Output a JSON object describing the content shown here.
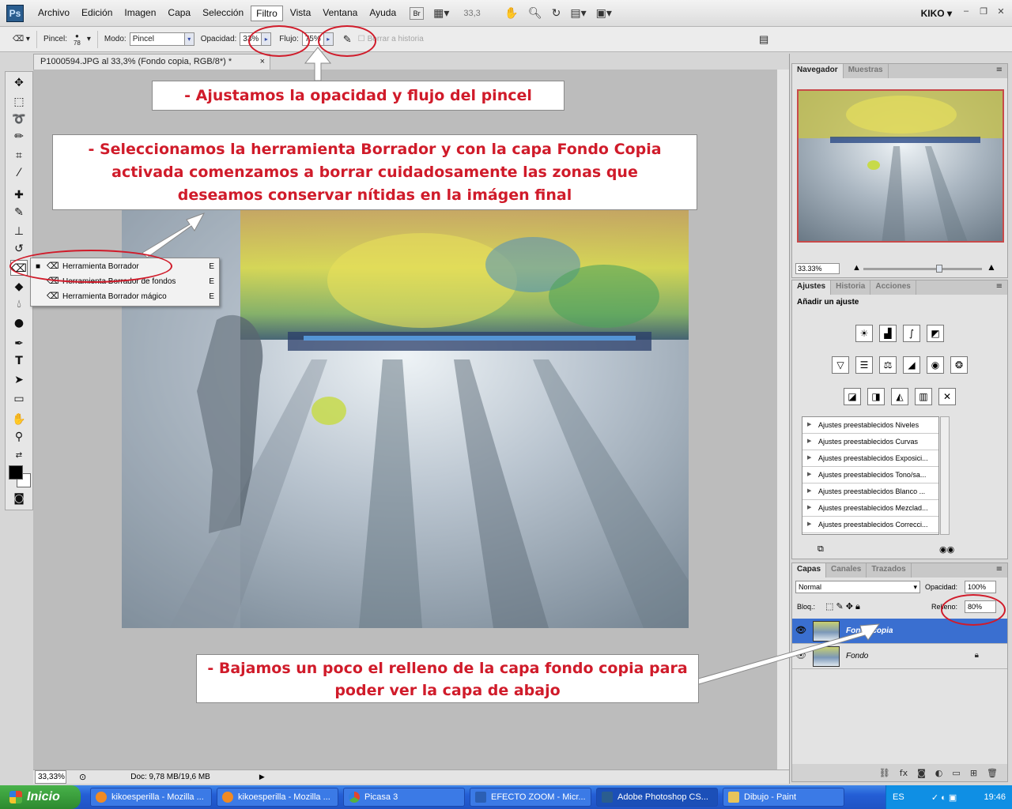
{
  "menubar": {
    "logo": "Ps",
    "items": [
      "Archivo",
      "Edición",
      "Imagen",
      "Capa",
      "Selección",
      "Filtro",
      "Vista",
      "Ventana",
      "Ayuda"
    ],
    "active_item": "Filtro",
    "bridge_label": "Br",
    "zoom": "33,3",
    "user": "KIKO"
  },
  "options": {
    "brush_label": "Pincel:",
    "brush_size": "78",
    "mode_label": "Modo:",
    "mode_value": "Pincel",
    "opacity_label": "Opacidad:",
    "opacity_value": "33%",
    "flow_label": "Flujo:",
    "flow_value": "75%",
    "history_label": "Borrar a historia"
  },
  "document": {
    "tab_title": "P1000594.JPG al 33,3% (Fondo copia, RGB/8*) *",
    "status_zoom": "33,33%",
    "status_doc": "Doc: 9,78 MB/19,6 MB"
  },
  "flyout": {
    "items": [
      {
        "label": "Herramienta Borrador",
        "key": "E"
      },
      {
        "label": "Herramienta Borrador de fondos",
        "key": "E"
      },
      {
        "label": "Herramienta Borrador mágico",
        "key": "E"
      }
    ]
  },
  "navigator": {
    "tabs": [
      "Navegador",
      "Muestras"
    ],
    "zoom": "33.33%"
  },
  "adjustments": {
    "tabs": [
      "Ajustes",
      "Historia",
      "Acciones"
    ],
    "title": "Añadir un ajuste",
    "presets": [
      "Ajustes preestablecidos Niveles",
      "Ajustes preestablecidos Curvas",
      "Ajustes preestablecidos Exposici...",
      "Ajustes preestablecidos Tono/sa...",
      "Ajustes preestablecidos Blanco ...",
      "Ajustes preestablecidos Mezclad...",
      "Ajustes preestablecidos Correcci..."
    ]
  },
  "layers": {
    "tabs": [
      "Capas",
      "Canales",
      "Trazados"
    ],
    "blend_mode": "Normal",
    "opacity_label": "Opacidad:",
    "opacity_value": "100%",
    "lock_label": "Bloq.:",
    "fill_label": "Relleno:",
    "fill_value": "80%",
    "items": [
      {
        "name": "Fondo copia",
        "selected": true
      },
      {
        "name": "Fondo",
        "selected": false
      }
    ]
  },
  "annotations": {
    "opacity_note": "- Ajustamos la opacidad y flujo del pincel",
    "eraser_note": "- Seleccionamos la herramienta Borrador y con la capa Fondo Copia  activada comenzamos a borrar  cuidadosamente  las zonas que deseamos conservar nítidas en la imágen final",
    "fill_note": "- Bajamos un poco el relleno de la capa fondo copia para poder ver la capa de abajo"
  },
  "taskbar": {
    "start": "Inicio",
    "tasks": [
      "kikoesperilla - Mozilla ...",
      "kikoesperilla - Mozilla ...",
      "Picasa 3",
      "EFECTO ZOOM - Micr...",
      "Adobe Photoshop CS...",
      "Dibujo - Paint"
    ],
    "active_task": "Adobe Photoshop CS...",
    "language": "ES",
    "clock": "19:46"
  },
  "colors": {
    "annotation_red": "#d01b2a",
    "selection_blue": "#3a6fd0",
    "taskbar_blue": "#245ed6"
  }
}
